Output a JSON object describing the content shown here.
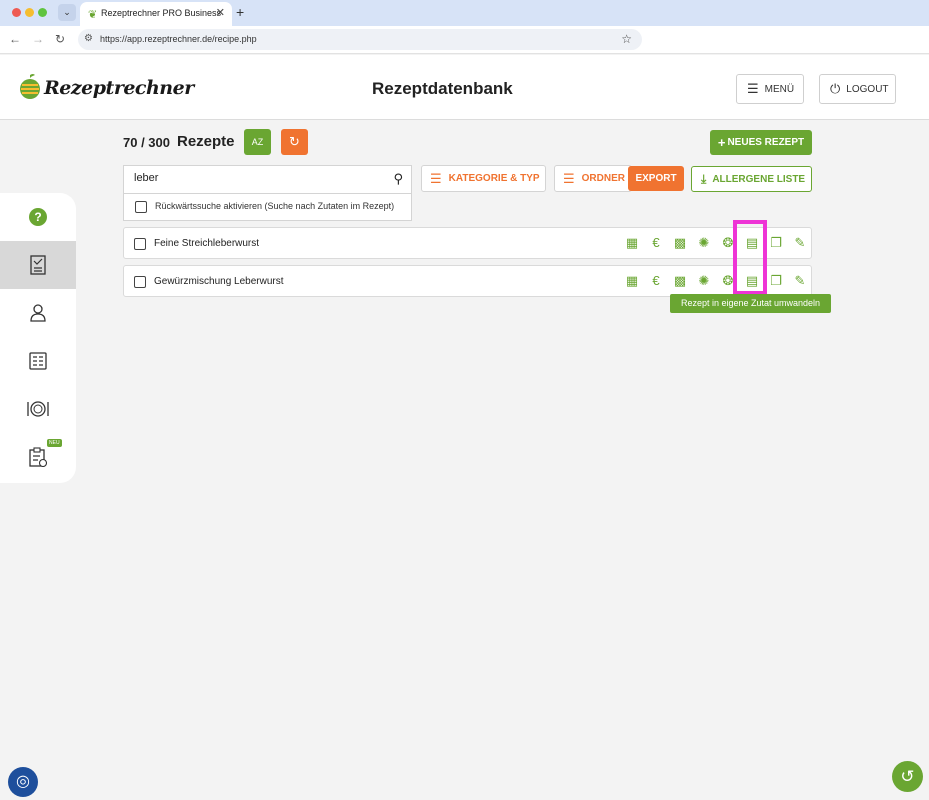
{
  "browser": {
    "tab_title": "Rezeptrechner PRO Business",
    "tab_close": "✕",
    "new_tab": "+",
    "url": "https://app.rezeptrechner.de/recipe.php"
  },
  "header": {
    "logo_text": "Rezeptrechner",
    "page_title": "Rezeptdatenbank",
    "menu_label": "MENÜ",
    "logout_label": "LOGOUT"
  },
  "sidebar": {
    "help_label": "?",
    "items": [
      {
        "name": "help",
        "icon": "question-circle-icon"
      },
      {
        "name": "recipes",
        "icon": "recipe-document-icon",
        "active": true
      },
      {
        "name": "profile",
        "icon": "user-icon"
      },
      {
        "name": "ingredients",
        "icon": "list-card-icon"
      },
      {
        "name": "menus",
        "icon": "plate-cutlery-icon"
      },
      {
        "name": "checklist",
        "icon": "clipboard-check-icon",
        "badge": "NEU"
      }
    ]
  },
  "toolbar": {
    "count": "70 / 300",
    "title": "Rezepte",
    "sort_label": "AZ",
    "new_recipe_label": "NEUES REZEPT",
    "search_value": "leber",
    "reverse_search_label": "Rückwärtssuche aktivieren (Suche nach Zutaten im Rezept)",
    "category_filter_label": "KATEGORIE & TYP",
    "folder_filter_label": "ORDNER",
    "export_label": "EXPORT",
    "allergen_label": "ALLERGENE LISTE"
  },
  "recipes": [
    {
      "name": "Feine Streichleberwurst"
    },
    {
      "name": "Gewürzmischung Leberwurst"
    }
  ],
  "tooltip": "Rezept in eigene Zutat umwandeln",
  "colors": {
    "accent_green": "#6aa632",
    "accent_orange": "#f07330",
    "highlight_magenta": "#ee34d6"
  }
}
